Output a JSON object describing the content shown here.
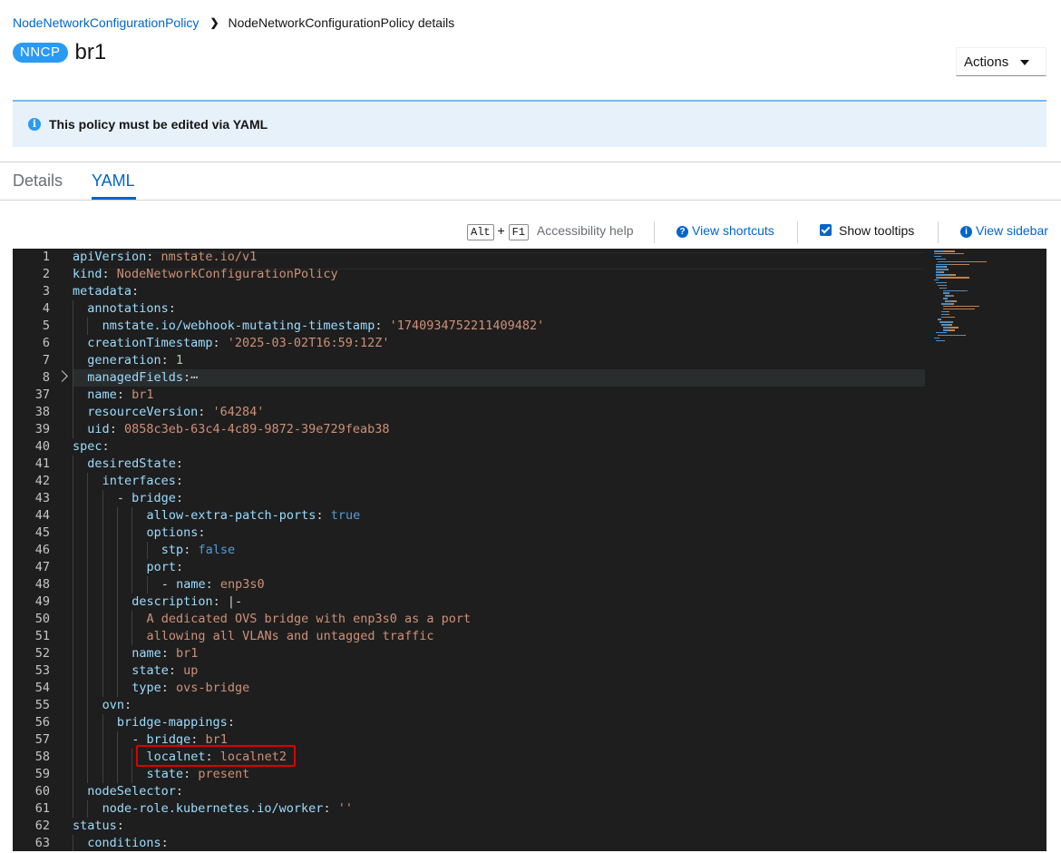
{
  "breadcrumb": {
    "parent": "NodeNetworkConfigurationPolicy",
    "current": "NodeNetworkConfigurationPolicy details"
  },
  "header": {
    "badge": "NNCP",
    "title": "br1",
    "actions_label": "Actions"
  },
  "alert": {
    "message": "This policy must be edited via YAML"
  },
  "tabs": [
    {
      "label": "Details",
      "active": false
    },
    {
      "label": "YAML",
      "active": true
    }
  ],
  "toolbar": {
    "key1": "Alt",
    "plus": "+",
    "key2": "F1",
    "accessibility_help": "Accessibility help",
    "view_shortcuts": "View shortcuts",
    "show_tooltips": "Show tooltips",
    "view_sidebar": "View sidebar"
  },
  "editor": {
    "lines": [
      {
        "num": "1",
        "indent": 0,
        "tokens": [
          [
            "k",
            "apiVersion"
          ],
          [
            "p",
            ": "
          ],
          [
            "v",
            "nmstate.io/v1"
          ]
        ]
      },
      {
        "num": "2",
        "indent": 0,
        "tokens": [
          [
            "k",
            "kind"
          ],
          [
            "p",
            ": "
          ],
          [
            "v",
            "NodeNetworkConfigurationPolicy"
          ]
        ]
      },
      {
        "num": "3",
        "indent": 0,
        "tokens": [
          [
            "k",
            "metadata"
          ],
          [
            "p",
            ":"
          ]
        ]
      },
      {
        "num": "4",
        "indent": 1,
        "tokens": [
          [
            "k",
            "annotations"
          ],
          [
            "p",
            ":"
          ]
        ]
      },
      {
        "num": "5",
        "indent": 2,
        "tokens": [
          [
            "k",
            "nmstate.io/webhook-mutating-timestamp"
          ],
          [
            "p",
            ": "
          ],
          [
            "s",
            "'1740934752211409482'"
          ]
        ]
      },
      {
        "num": "6",
        "indent": 1,
        "tokens": [
          [
            "k",
            "creationTimestamp"
          ],
          [
            "p",
            ": "
          ],
          [
            "s",
            "'2025-03-02T16:59:12Z'"
          ]
        ]
      },
      {
        "num": "7",
        "indent": 1,
        "tokens": [
          [
            "k",
            "generation"
          ],
          [
            "p",
            ": "
          ],
          [
            "n",
            "1"
          ]
        ]
      },
      {
        "num": "8",
        "indent": 1,
        "tokens": [
          [
            "k",
            "managedFields"
          ],
          [
            "p",
            ":"
          ],
          [
            "p",
            "⋯"
          ]
        ]
      },
      {
        "num": "37",
        "indent": 1,
        "tokens": [
          [
            "k",
            "name"
          ],
          [
            "p",
            ": "
          ],
          [
            "v",
            "br1"
          ]
        ]
      },
      {
        "num": "38",
        "indent": 1,
        "tokens": [
          [
            "k",
            "resourceVersion"
          ],
          [
            "p",
            ": "
          ],
          [
            "s",
            "'64284'"
          ]
        ]
      },
      {
        "num": "39",
        "indent": 1,
        "tokens": [
          [
            "k",
            "uid"
          ],
          [
            "p",
            ": "
          ],
          [
            "v",
            "0858c3eb-63c4-4c89-9872-39e729feab38"
          ]
        ]
      },
      {
        "num": "40",
        "indent": 0,
        "tokens": [
          [
            "k",
            "spec"
          ],
          [
            "p",
            ":"
          ]
        ]
      },
      {
        "num": "41",
        "indent": 1,
        "tokens": [
          [
            "k",
            "desiredState"
          ],
          [
            "p",
            ":"
          ]
        ]
      },
      {
        "num": "42",
        "indent": 2,
        "tokens": [
          [
            "k",
            "interfaces"
          ],
          [
            "p",
            ":"
          ]
        ]
      },
      {
        "num": "43",
        "indent": 3,
        "tokens": [
          [
            "p",
            "- "
          ],
          [
            "k",
            "bridge"
          ],
          [
            "p",
            ":"
          ]
        ]
      },
      {
        "num": "44",
        "indent": 5,
        "tokens": [
          [
            "k",
            "allow-extra-patch-ports"
          ],
          [
            "p",
            ": "
          ],
          [
            "b",
            "true"
          ]
        ]
      },
      {
        "num": "45",
        "indent": 5,
        "tokens": [
          [
            "k",
            "options"
          ],
          [
            "p",
            ":"
          ]
        ]
      },
      {
        "num": "46",
        "indent": 6,
        "tokens": [
          [
            "k",
            "stp"
          ],
          [
            "p",
            ": "
          ],
          [
            "b",
            "false"
          ]
        ]
      },
      {
        "num": "47",
        "indent": 5,
        "tokens": [
          [
            "k",
            "port"
          ],
          [
            "p",
            ":"
          ]
        ]
      },
      {
        "num": "48",
        "indent": 6,
        "tokens": [
          [
            "p",
            "- "
          ],
          [
            "k",
            "name"
          ],
          [
            "p",
            ": "
          ],
          [
            "v",
            "enp3s0"
          ]
        ]
      },
      {
        "num": "49",
        "indent": 4,
        "tokens": [
          [
            "k",
            "description"
          ],
          [
            "p",
            ": "
          ],
          [
            "p",
            "|-"
          ]
        ]
      },
      {
        "num": "50",
        "indent": 5,
        "tokens": [
          [
            "v",
            "A dedicated OVS bridge with enp3s0 as a port"
          ]
        ]
      },
      {
        "num": "51",
        "indent": 5,
        "tokens": [
          [
            "v",
            "allowing all VLANs and untagged traffic"
          ]
        ]
      },
      {
        "num": "52",
        "indent": 4,
        "tokens": [
          [
            "k",
            "name"
          ],
          [
            "p",
            ": "
          ],
          [
            "v",
            "br1"
          ]
        ]
      },
      {
        "num": "53",
        "indent": 4,
        "tokens": [
          [
            "k",
            "state"
          ],
          [
            "p",
            ": "
          ],
          [
            "v",
            "up"
          ]
        ]
      },
      {
        "num": "54",
        "indent": 4,
        "tokens": [
          [
            "k",
            "type"
          ],
          [
            "p",
            ": "
          ],
          [
            "v",
            "ovs-bridge"
          ]
        ]
      },
      {
        "num": "55",
        "indent": 2,
        "tokens": [
          [
            "k",
            "ovn"
          ],
          [
            "p",
            ":"
          ]
        ]
      },
      {
        "num": "56",
        "indent": 3,
        "tokens": [
          [
            "k",
            "bridge-mappings"
          ],
          [
            "p",
            ":"
          ]
        ]
      },
      {
        "num": "57",
        "indent": 4,
        "tokens": [
          [
            "p",
            "- "
          ],
          [
            "k",
            "bridge"
          ],
          [
            "p",
            ": "
          ],
          [
            "v",
            "br1"
          ]
        ]
      },
      {
        "num": "58",
        "indent": 5,
        "tokens": [
          [
            "k",
            "localnet"
          ],
          [
            "p",
            ": "
          ],
          [
            "v",
            "localnet2"
          ]
        ]
      },
      {
        "num": "59",
        "indent": 5,
        "tokens": [
          [
            "k",
            "state"
          ],
          [
            "p",
            ": "
          ],
          [
            "v",
            "present"
          ]
        ]
      },
      {
        "num": "60",
        "indent": 1,
        "tokens": [
          [
            "k",
            "nodeSelector"
          ],
          [
            "p",
            ":"
          ]
        ]
      },
      {
        "num": "61",
        "indent": 2,
        "tokens": [
          [
            "k",
            "node-role.kubernetes.io/worker"
          ],
          [
            "p",
            ": "
          ],
          [
            "s",
            "''"
          ]
        ]
      },
      {
        "num": "62",
        "indent": 0,
        "tokens": [
          [
            "k",
            "status"
          ],
          [
            "p",
            ":"
          ]
        ]
      },
      {
        "num": "63",
        "indent": 1,
        "tokens": [
          [
            "k",
            "conditions"
          ],
          [
            "p",
            ":"
          ]
        ]
      }
    ]
  }
}
